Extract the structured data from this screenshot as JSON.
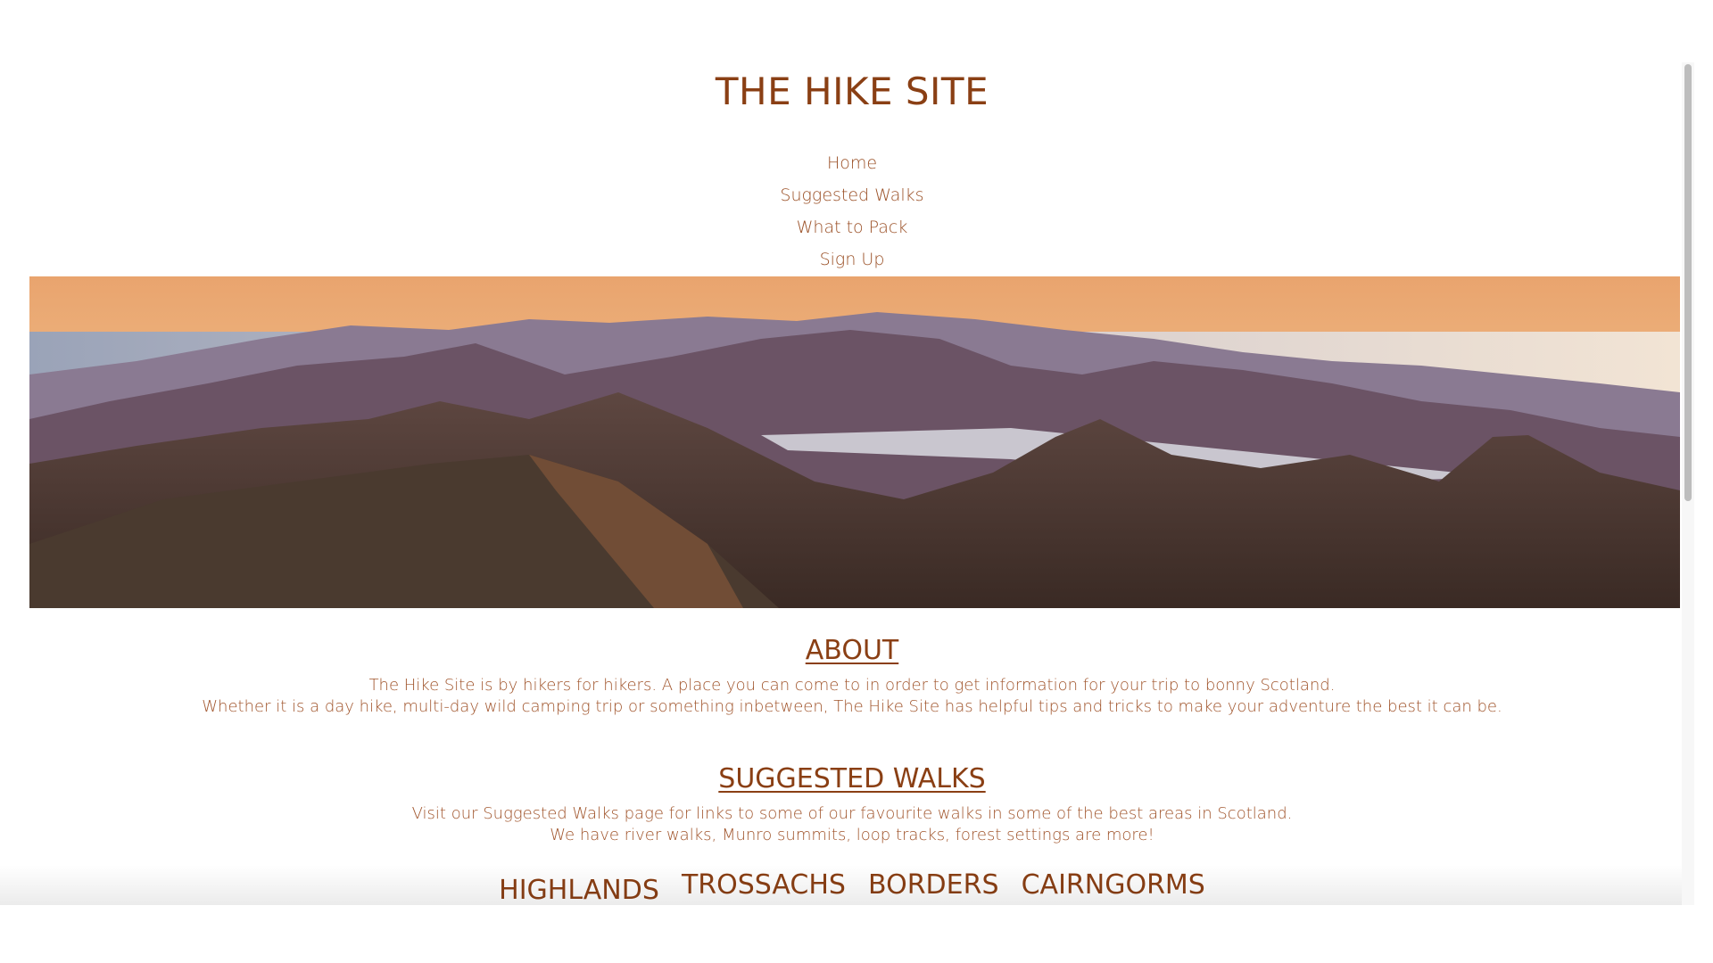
{
  "site": {
    "title": "THE HIKE SITE"
  },
  "nav": {
    "items": [
      {
        "label": "Home"
      },
      {
        "label": "Suggested Walks"
      },
      {
        "label": "What to Pack"
      },
      {
        "label": "Sign Up"
      }
    ]
  },
  "hero": {
    "icon": "mountain-landscape-image",
    "colors": {
      "sky_top": "#e9a46e",
      "sky_bottom": "#f7d6a3",
      "water": "#c9c6cf",
      "far_mountains": "#8a7a92",
      "mid_mountains": "#6b5365",
      "near_mountains": "#4e3a33",
      "foreground": "#3d2c25"
    }
  },
  "about": {
    "heading": "ABOUT",
    "line1": "The Hike Site is by hikers for hikers. A place you can come to in order to get information for your trip to bonny Scotland.",
    "line2": "Whether it is a day hike, multi-day wild camping trip or something inbetween, The Hike Site has helpful tips and tricks to make your adventure the best it can be."
  },
  "suggested": {
    "heading": "SUGGESTED WALKS",
    "line1": "Visit our Suggested Walks page for links to some of our favourite walks in some of the best areas in Scotland.",
    "line2": "We have river walks, Munro summits, loop tracks, forest settings are more!"
  },
  "regions": [
    {
      "label": "HIGHLANDS"
    },
    {
      "label": "TROSSACHS"
    },
    {
      "label": "BORDERS"
    },
    {
      "label": "CAIRNGORMS"
    }
  ],
  "colors": {
    "accent": "#8a3f14",
    "text": "#a0542b",
    "background": "#ffffff"
  }
}
